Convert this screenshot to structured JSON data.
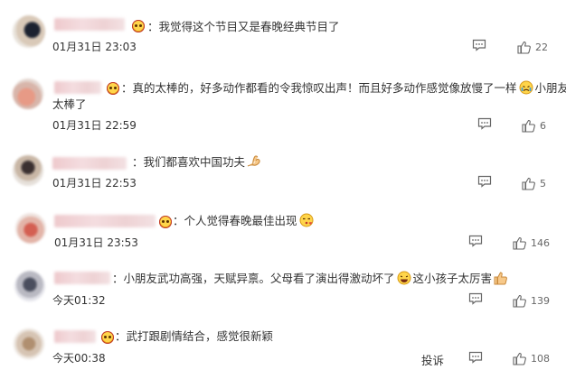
{
  "comments": [
    {
      "text": "我觉得这个节目又是春晚经典节目了",
      "time": "01月31日 23:03",
      "likes": "22"
    },
    {
      "text_line1": "真的太棒的，好多动作都看的令我惊叹出声！而且好多动作感觉像放慢了一样",
      "text_line1_end": "小朋友",
      "text_line2": "太棒了",
      "time": "01月31日 22:59",
      "likes": "6"
    },
    {
      "text": "我们都喜欢中国功夫",
      "time": "01月31日 22:53",
      "likes": "5"
    },
    {
      "text": "个人觉得春晚最佳出现",
      "time": "01月31日 23:53",
      "likes": "146"
    },
    {
      "text": "小朋友武功高强，天赋异禀。父母看了演出得激动坏了",
      "text_end": "这小孩子太厉害",
      "time": "今天01:32",
      "likes": "139"
    },
    {
      "text": "武打跟剧情结合，感觉很新颖",
      "time": "今天00:38",
      "report": "投诉",
      "likes": "108"
    }
  ]
}
